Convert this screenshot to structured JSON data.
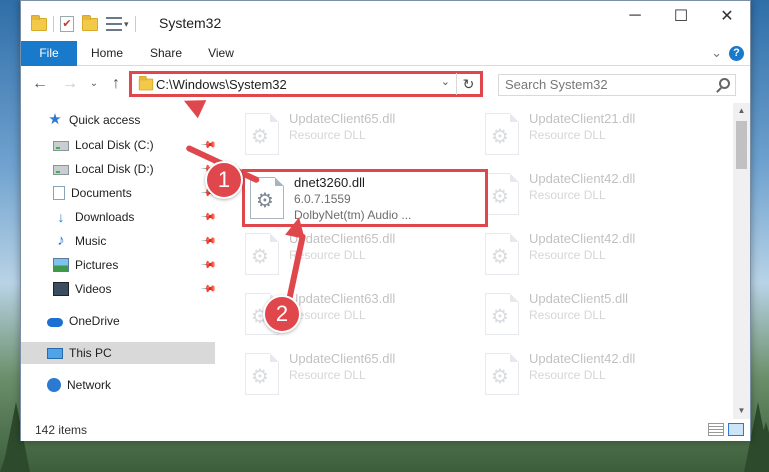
{
  "window": {
    "title": "System32"
  },
  "ribbon": {
    "tabs": [
      "File",
      "Home",
      "Share",
      "View"
    ]
  },
  "address": {
    "path": "C:\\Windows\\System32"
  },
  "search": {
    "placeholder": "Search System32"
  },
  "nav": {
    "items": [
      {
        "label": "Quick access",
        "icon": "star-icon"
      },
      {
        "label": "Local Disk (C:)",
        "icon": "drive-icon",
        "pinned": true
      },
      {
        "label": "Local Disk (D:)",
        "icon": "drive-icon",
        "pinned": true
      },
      {
        "label": "Documents",
        "icon": "documents-icon",
        "pinned": true
      },
      {
        "label": "Downloads",
        "icon": "downloads-icon",
        "pinned": true
      },
      {
        "label": "Music",
        "icon": "music-icon",
        "pinned": true
      },
      {
        "label": "Pictures",
        "icon": "pictures-icon",
        "pinned": true
      },
      {
        "label": "Videos",
        "icon": "videos-icon",
        "pinned": true
      },
      {
        "label": "OneDrive",
        "icon": "onedrive-icon"
      },
      {
        "label": "This PC",
        "icon": "this-pc-icon",
        "selected": true
      },
      {
        "label": "Network",
        "icon": "network-icon"
      }
    ]
  },
  "files": {
    "background": [
      {
        "name": "UpdateClient65.dll",
        "type": "Resource DLL"
      },
      {
        "name": "UpdateClient21.dll",
        "type": "Resource DLL"
      },
      {
        "name": "UpdateClient42.dll",
        "type": "Resource DLL"
      },
      {
        "name": "UpdateClient65.dll",
        "type": "Resource DLL"
      },
      {
        "name": "UpdateClient42.dll",
        "type": "Resource DLL"
      },
      {
        "name": "UpdateClient63.dll",
        "type": "Resource DLL"
      },
      {
        "name": "UpdateClient5.dll",
        "type": "Resource DLL"
      },
      {
        "name": "UpdateClient65.dll",
        "type": "Resource DLL"
      },
      {
        "name": "UpdateClient42.dll",
        "type": "Resource DLL"
      }
    ],
    "highlighted": {
      "name": "dnet3260.dll",
      "version": "6.0.7.1559",
      "description": "DolbyNet(tm) Audio ..."
    }
  },
  "status": {
    "item_count": "142 items"
  },
  "annotations": {
    "step1": "1",
    "step2": "2",
    "color": "#e0474c"
  },
  "icons": {
    "help": "?",
    "refresh": "↻"
  }
}
